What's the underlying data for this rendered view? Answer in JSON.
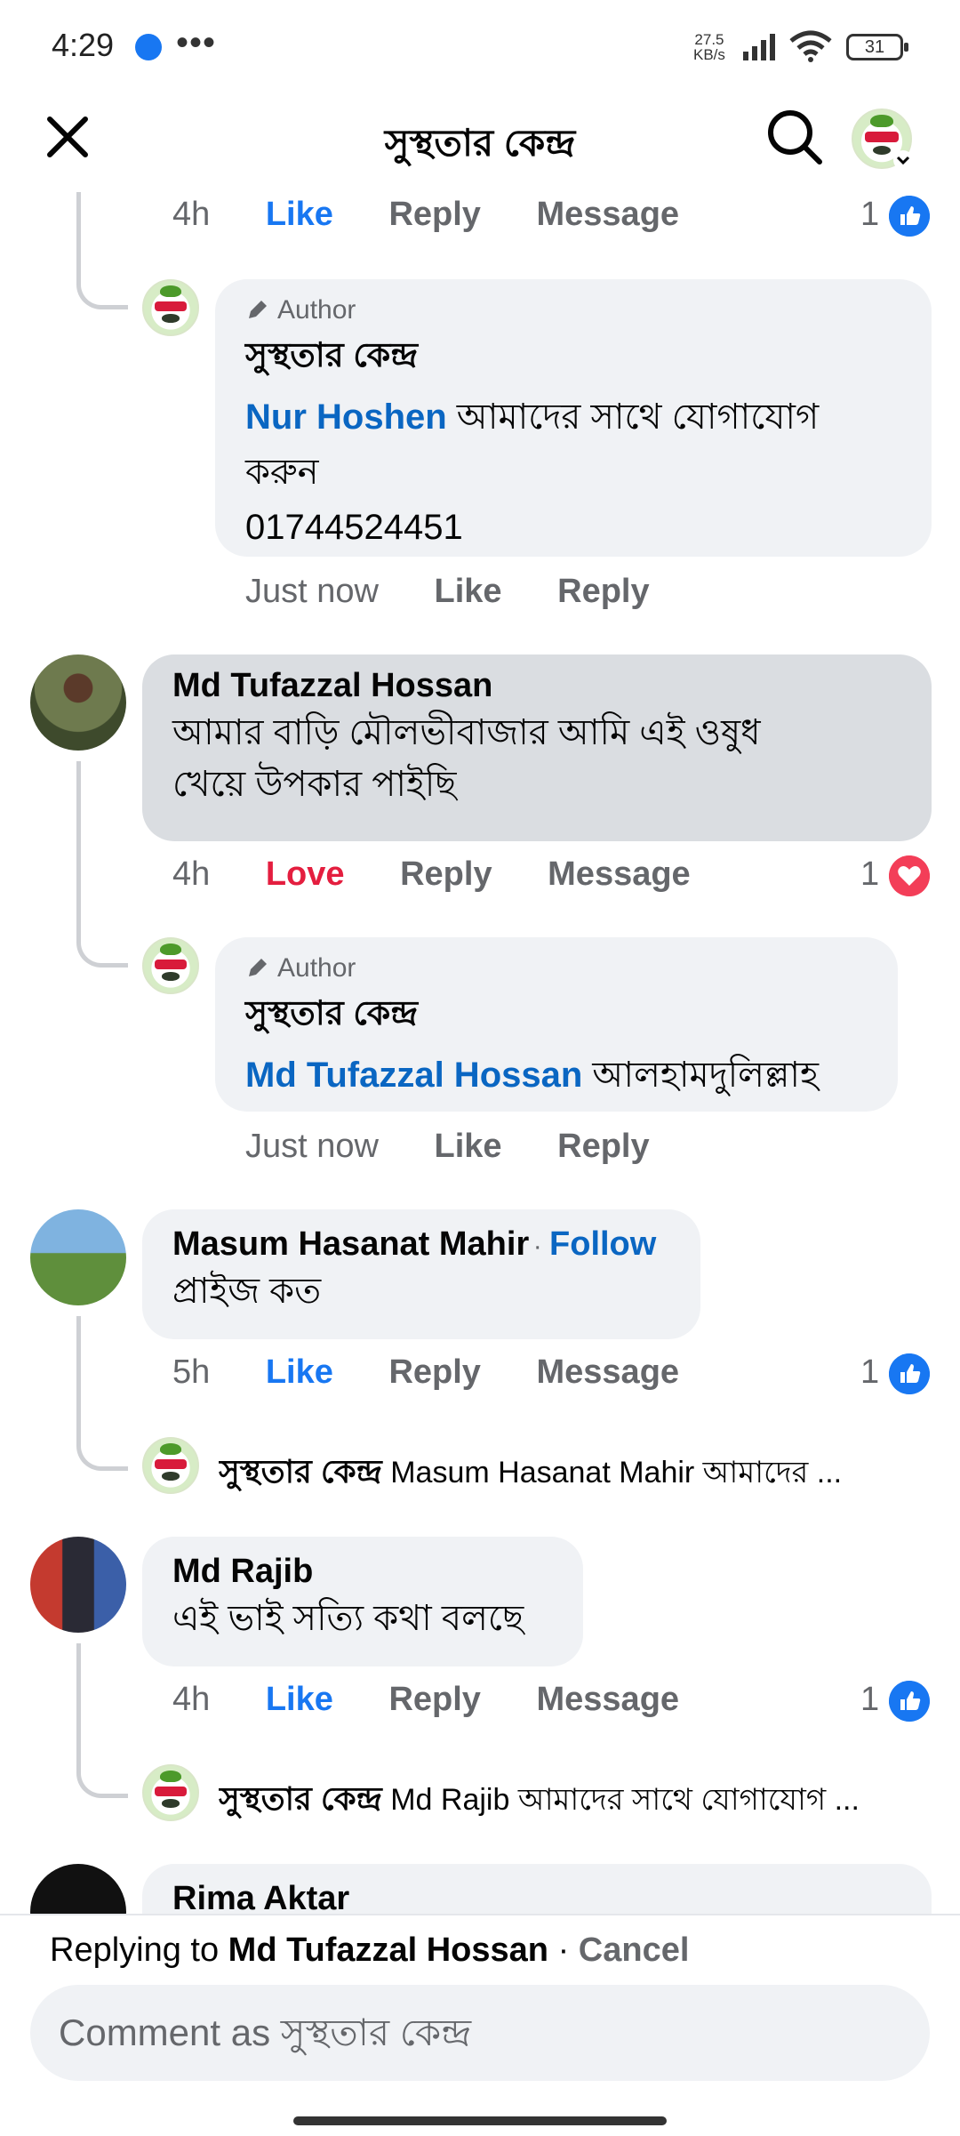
{
  "status": {
    "time": "4:29",
    "dots": "•••",
    "speed_top": "27.5",
    "speed_unit": "KB/s",
    "battery": "31"
  },
  "header": {
    "title": "সুস্থতার কেন্দ্র"
  },
  "comments": [
    {
      "id": "c0",
      "actions": {
        "time": "4h",
        "reaction": "Like",
        "reply": "Reply",
        "message": "Message",
        "count": "1"
      },
      "reply": {
        "author_tag": "Author",
        "name": "সুস্থতার কেন্দ্র",
        "mention": "Nur Hoshen",
        "text1": " আমাদের সাথে যোগাযোগ",
        "text2": "করুন",
        "text3": "01744524451",
        "time": "Just now",
        "like": "Like",
        "reply": "Reply"
      }
    },
    {
      "id": "c1",
      "name": "Md Tufazzal Hossan",
      "text1": "আমার বাড়ি মৌলভীবাজার আমি এই ওষুধ",
      "text2": "খেয়ে উপকার পাইছি",
      "actions": {
        "time": "4h",
        "reaction": "Love",
        "reply": "Reply",
        "message": "Message",
        "count": "1"
      },
      "reply": {
        "author_tag": "Author",
        "name": "সুস্থতার কেন্দ্র",
        "mention": "Md Tufazzal Hossan",
        "text": " আলহামদুলিল্লাহ",
        "time": "Just now",
        "like": "Like",
        "reply": "Reply"
      }
    },
    {
      "id": "c2",
      "name": "Masum Hasanat Mahir",
      "follow": "Follow",
      "text": "প্রাইজ কত",
      "actions": {
        "time": "5h",
        "reaction": "Like",
        "reply": "Reply",
        "message": "Message",
        "count": "1"
      },
      "collapsed_reply": {
        "name": "সুস্থতার কেন্দ্র",
        "text": " Masum Hasanat Mahir আমাদের ..."
      }
    },
    {
      "id": "c3",
      "name": "Md Rajib",
      "text": "এই ভাই সত্যি কথা বলছে",
      "actions": {
        "time": "4h",
        "reaction": "Like",
        "reply": "Reply",
        "message": "Message",
        "count": "1"
      },
      "collapsed_reply": {
        "name": "সুস্থতার কেন্দ্র",
        "text": " Md Rajib আমাদের সাথে যোগাযোগ ..."
      }
    },
    {
      "id": "c4",
      "name": "Rima Aktar"
    }
  ],
  "composer": {
    "replying_prefix": "Replying to ",
    "replying_to": "Md Tufazzal Hossan",
    "sep": " · ",
    "cancel": "Cancel",
    "placeholder": "Comment as সুস্থতার কেন্দ্র"
  }
}
